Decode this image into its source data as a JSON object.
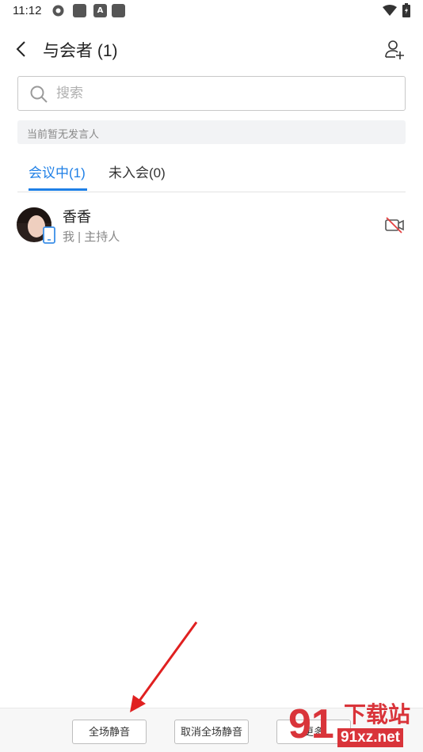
{
  "status_bar": {
    "time": "11:12"
  },
  "header": {
    "title": "与会者 (1)"
  },
  "search": {
    "placeholder": "搜索",
    "value": ""
  },
  "notice": {
    "text": "当前暂无发言人"
  },
  "tabs": [
    {
      "label": "会议中(1)",
      "active": true
    },
    {
      "label": "未入会(0)",
      "active": false
    }
  ],
  "participants": [
    {
      "name": "香香",
      "role": "我 | 主持人"
    }
  ],
  "bottom": {
    "mute_all_label": "全场静音",
    "unmute_all_label": "取消全场静音",
    "more_label": "更多"
  },
  "watermark": {
    "number": "91",
    "top": "下载站",
    "bottom": "91xz.net"
  },
  "colors": {
    "accent": "#1e7fe6",
    "red": "#d9343a"
  }
}
